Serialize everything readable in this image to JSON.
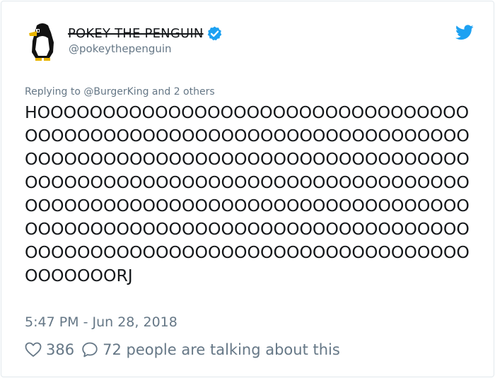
{
  "author": {
    "display_name": "POKEY THE PENGUIN",
    "handle": "@pokeythepenguin",
    "verified": true
  },
  "reply_context": "Replying to @BurgerKing and 2 others",
  "tweet_text": "HOOOOOOOOOOOOOOOOOOOOOOOOOOOOOOOOOOOOOOOOOOOOOOOOOOOOOOOOOOOOOOOOOOOOOOOOOOOOOOOOOOOOOOOOOOOOOOOOOOOOOOOOOOOOOOOOOOOOOOOOOOOOOOOOOOOOOOOOOOOOOOOOOOOOOOOOOOOOOOOOOOOOOOOOOOOOOOOOOOOOOOOOOOOOOOOOOOOOOOOOOOOOOOOOOOOOOOOOOOOOOOOOOOOOOOOOOOOOOOOOOOOORJ",
  "timestamp": "5:47 PM - Jun 28, 2018",
  "engagement": {
    "likes": "386",
    "talking": "72 people are talking about this"
  },
  "icons": {
    "brand": "twitter-bird-icon",
    "verified": "verified-badge-icon",
    "like": "heart-icon",
    "reply": "speech-bubble-icon"
  },
  "colors": {
    "twitter_blue": "#1da1f2",
    "secondary_text": "#657786",
    "primary_text": "#14171a"
  }
}
